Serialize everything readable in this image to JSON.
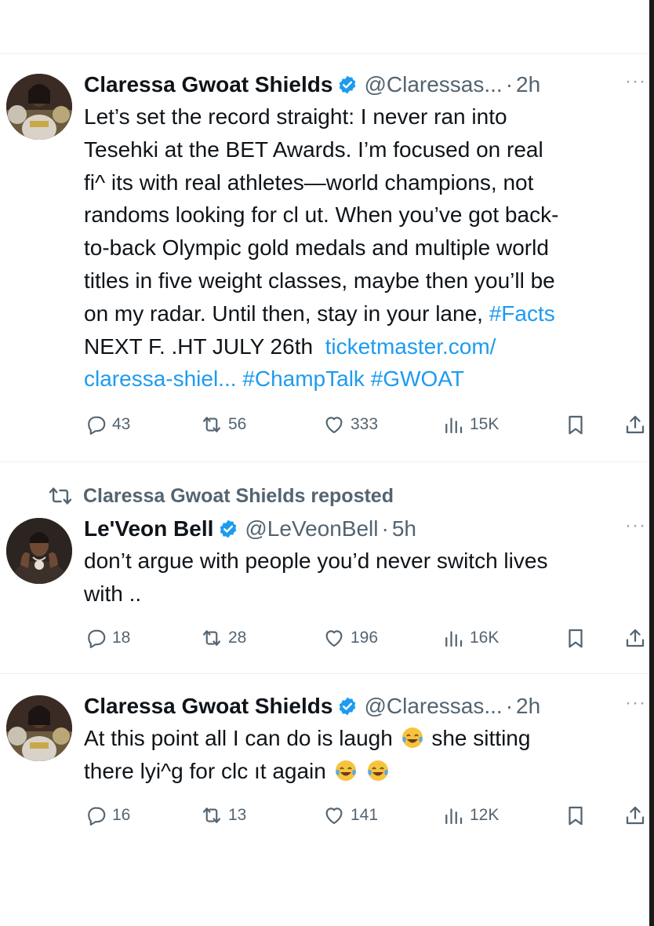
{
  "tweets": [
    {
      "name": "Claressa Gwoat Shields",
      "handle": "@Claressas...",
      "time": "2h",
      "lines": [
        "Let’s set the record straight: I never ran into",
        "Tesehki at the BET Awards. I’m focused on real",
        "fi^ its with real athletes—world champions, not",
        "randoms looking for cl  ut. When you’ve got back-",
        "to-back Olympic gold medals and multiple world",
        "titles in five weight classes, maybe then you’ll be",
        "on my radar. Until then, stay in your lane,"
      ],
      "hashtag_facts": "#Facts",
      "next_fight": "NEXT F.  .HT JULY 26th",
      "link_domain": "ticketmaster.com/",
      "link_path": "claressa-shiel...",
      "hashtag_champ": "#ChampTalk",
      "hashtag_gwoat": "#GWOAT",
      "replies": "43",
      "reposts": "56",
      "likes": "333",
      "views": "15K"
    },
    {
      "repost_label": "Claressa Gwoat Shields reposted",
      "name": "Le'Veon Bell",
      "handle": "@LeVeonBell",
      "time": "5h",
      "lines": [
        "don’t argue with people you’d never switch lives",
        "with .."
      ],
      "replies": "18",
      "reposts": "28",
      "likes": "196",
      "views": "16K"
    },
    {
      "name": "Claressa Gwoat Shields",
      "handle": "@Claressas...",
      "time": "2h",
      "line1_before_emoji": "At this point all I can do is laugh",
      "line1_after_emoji": "she sitting",
      "line2": "there lyi^g for clc  ıt again",
      "replies": "16",
      "reposts": "13",
      "likes": "141",
      "views": "12K"
    }
  ],
  "icons": {
    "verified": "verified-badge-icon",
    "more": "more-dots-icon",
    "reply": "reply-icon",
    "repost": "repost-icon",
    "like": "heart-icon",
    "views": "views-bar-icon",
    "bookmark": "bookmark-icon",
    "share": "share-icon",
    "emoji": "tears-of-joy-emoji"
  },
  "colors": {
    "link": "#1d9bf0",
    "verified": "#1d9bf0",
    "secondary": "#536471",
    "text": "#0f1419"
  },
  "more_glyph": "···"
}
